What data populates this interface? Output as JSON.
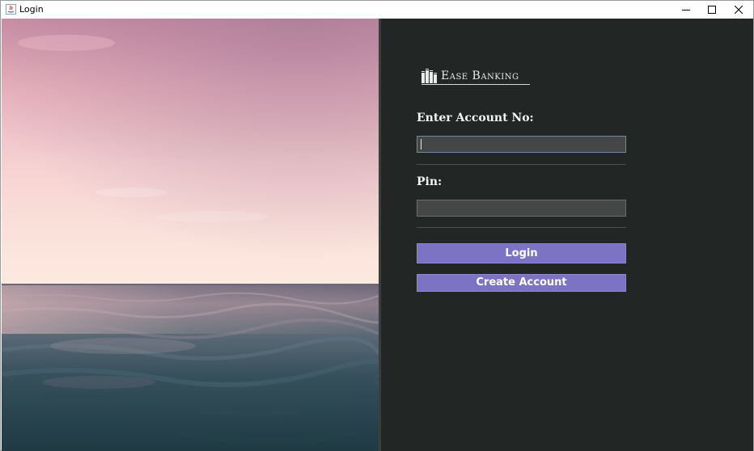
{
  "window": {
    "title": "Login",
    "controls": {
      "minimize_icon": "minimize-icon",
      "maximize_icon": "maximize-icon",
      "close_icon": "close-icon"
    }
  },
  "brand": {
    "name": "Ease Banking",
    "icon": "bank-columns-icon"
  },
  "form": {
    "account_label": "Enter Account No:",
    "account_value": "",
    "pin_label": "Pin:",
    "pin_value": "",
    "login_label": "Login",
    "create_account_label": "Create Account"
  },
  "colors": {
    "form_background": "#222624",
    "input_background": "#444746",
    "button_background": "#7c73c4",
    "label_text": "#f4f4f4"
  }
}
